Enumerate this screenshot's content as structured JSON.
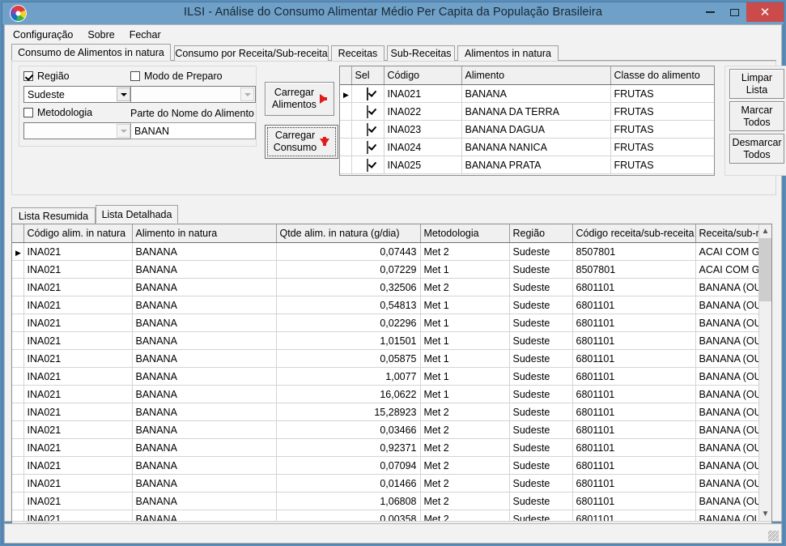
{
  "window": {
    "title": "ILSI - Análise do Consumo Alimentar Médio Per Capita da População Brasileira",
    "minimize_label": "Minimizar",
    "maximize_label": "Maximizar",
    "close_label": "Fechar"
  },
  "menu": {
    "items": [
      {
        "label": "Configuração"
      },
      {
        "label": "Sobre"
      },
      {
        "label": "Fechar"
      }
    ]
  },
  "top_tabs": {
    "active_index": 0,
    "items": [
      {
        "label": "Consumo de Alimentos in natura"
      },
      {
        "label": "Consumo por Receita/Sub-receita"
      },
      {
        "label": "Receitas"
      },
      {
        "label": "Sub-Receitas"
      },
      {
        "label": "Alimentos in natura"
      }
    ]
  },
  "filters": {
    "regiao": {
      "checkbox_label": "Região",
      "checked": true,
      "value": "Sudeste"
    },
    "metodologia": {
      "checkbox_label": "Metodologia",
      "checked": false,
      "value": ""
    },
    "modo_preparo": {
      "checkbox_label": "Modo de Preparo",
      "checked": false,
      "value": ""
    },
    "nome_alimento": {
      "label": "Parte do Nome do Alimento",
      "value": "BANAN",
      "placeholder": ""
    }
  },
  "actions": {
    "carregar_alimentos": {
      "line1": "Carregar",
      "line2": "Alimentos",
      "icon": "arrow-right-icon"
    },
    "carregar_consumo": {
      "line1": "Carregar",
      "line2": "Consumo",
      "icon": "arrow-down-icon"
    },
    "limpar_lista": {
      "line1": "Limpar",
      "line2": "Lista"
    },
    "marcar_todos": {
      "line1": "Marcar",
      "line2": "Todos"
    },
    "desmarcar_todos": {
      "line1": "Desmarcar",
      "line2": "Todos"
    }
  },
  "foods_grid": {
    "columns": [
      "Sel",
      "Código",
      "Alimento",
      "Classe do alimento"
    ],
    "selected_row_index": 0,
    "rows": [
      {
        "sel": true,
        "codigo": "INA021",
        "alimento": "BANANA",
        "classe": "FRUTAS"
      },
      {
        "sel": true,
        "codigo": "INA022",
        "alimento": "BANANA DA TERRA",
        "classe": "FRUTAS"
      },
      {
        "sel": true,
        "codigo": "INA023",
        "alimento": "BANANA DAGUA",
        "classe": "FRUTAS"
      },
      {
        "sel": true,
        "codigo": "INA024",
        "alimento": "BANANA NANICA",
        "classe": "FRUTAS"
      },
      {
        "sel": true,
        "codigo": "INA025",
        "alimento": "BANANA PRATA",
        "classe": "FRUTAS"
      }
    ]
  },
  "bottom_tabs": {
    "active_index": 1,
    "items": [
      {
        "label": "Lista Resumida"
      },
      {
        "label": "Lista Detalhada"
      }
    ]
  },
  "detail_grid": {
    "columns": [
      "Código alim. in natura",
      "Alimento in natura",
      "Qtde alim. in natura (g/dia)",
      "Metodologia",
      "Região",
      "Código receita/sub-receita",
      "Receita/sub-rec"
    ],
    "selected_row_index": 0,
    "rows": [
      {
        "codigo": "INA021",
        "alimento": "BANANA",
        "qtde": "0,07443",
        "metodologia": "Met 2",
        "regiao": "Sudeste",
        "cod_receita": "8507801",
        "receita": "ACAI COM GRA"
      },
      {
        "codigo": "INA021",
        "alimento": "BANANA",
        "qtde": "0,07229",
        "metodologia": "Met 1",
        "regiao": "Sudeste",
        "cod_receita": "8507801",
        "receita": "ACAI COM GRA"
      },
      {
        "codigo": "INA021",
        "alimento": "BANANA",
        "qtde": "0,32506",
        "metodologia": "Met 2",
        "regiao": "Sudeste",
        "cod_receita": "6801101",
        "receita": "BANANA (OURO"
      },
      {
        "codigo": "INA021",
        "alimento": "BANANA",
        "qtde": "0,54813",
        "metodologia": "Met 1",
        "regiao": "Sudeste",
        "cod_receita": "6801101",
        "receita": "BANANA (OURO"
      },
      {
        "codigo": "INA021",
        "alimento": "BANANA",
        "qtde": "0,02296",
        "metodologia": "Met 1",
        "regiao": "Sudeste",
        "cod_receita": "6801101",
        "receita": "BANANA (OURO"
      },
      {
        "codigo": "INA021",
        "alimento": "BANANA",
        "qtde": "1,01501",
        "metodologia": "Met 1",
        "regiao": "Sudeste",
        "cod_receita": "6801101",
        "receita": "BANANA (OURO"
      },
      {
        "codigo": "INA021",
        "alimento": "BANANA",
        "qtde": "0,05875",
        "metodologia": "Met 1",
        "regiao": "Sudeste",
        "cod_receita": "6801101",
        "receita": "BANANA (OURO"
      },
      {
        "codigo": "INA021",
        "alimento": "BANANA",
        "qtde": "1,0077",
        "metodologia": "Met 1",
        "regiao": "Sudeste",
        "cod_receita": "6801101",
        "receita": "BANANA (OURO"
      },
      {
        "codigo": "INA021",
        "alimento": "BANANA",
        "qtde": "16,0622",
        "metodologia": "Met 1",
        "regiao": "Sudeste",
        "cod_receita": "6801101",
        "receita": "BANANA (OURO"
      },
      {
        "codigo": "INA021",
        "alimento": "BANANA",
        "qtde": "15,28923",
        "metodologia": "Met 2",
        "regiao": "Sudeste",
        "cod_receita": "6801101",
        "receita": "BANANA (OURO"
      },
      {
        "codigo": "INA021",
        "alimento": "BANANA",
        "qtde": "0,03466",
        "metodologia": "Met 2",
        "regiao": "Sudeste",
        "cod_receita": "6801101",
        "receita": "BANANA (OURO"
      },
      {
        "codigo": "INA021",
        "alimento": "BANANA",
        "qtde": "0,92371",
        "metodologia": "Met 2",
        "regiao": "Sudeste",
        "cod_receita": "6801101",
        "receita": "BANANA (OURO"
      },
      {
        "codigo": "INA021",
        "alimento": "BANANA",
        "qtde": "0,07094",
        "metodologia": "Met 2",
        "regiao": "Sudeste",
        "cod_receita": "6801101",
        "receita": "BANANA (OURO"
      },
      {
        "codigo": "INA021",
        "alimento": "BANANA",
        "qtde": "0,01466",
        "metodologia": "Met 2",
        "regiao": "Sudeste",
        "cod_receita": "6801101",
        "receita": "BANANA (OURO"
      },
      {
        "codigo": "INA021",
        "alimento": "BANANA",
        "qtde": "1,06808",
        "metodologia": "Met 2",
        "regiao": "Sudeste",
        "cod_receita": "6801101",
        "receita": "BANANA (OURO"
      },
      {
        "codigo": "INA021",
        "alimento": "BANANA",
        "qtde": "0,00358",
        "metodologia": "Met 2",
        "regiao": "Sudeste",
        "cod_receita": "6801101",
        "receita": "BANANA (OURO"
      }
    ]
  }
}
